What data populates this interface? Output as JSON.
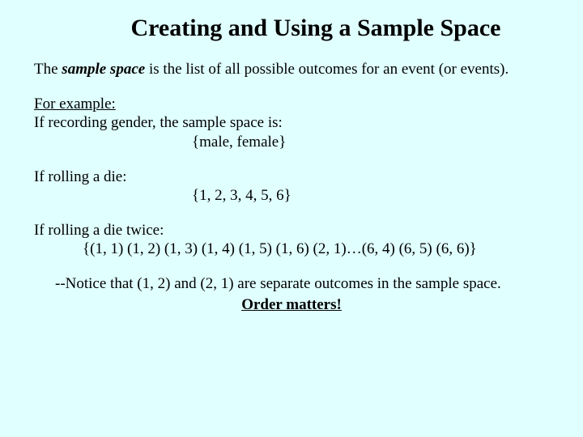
{
  "title": "Creating and Using a Sample Space",
  "intro": {
    "pre": "The ",
    "term": "sample space",
    "post": " is the list of all possible outcomes for an event (or events)."
  },
  "example_label": "For example:",
  "ex1": {
    "prompt": "If recording gender, the sample space is:",
    "space": "{male, female}"
  },
  "ex2": {
    "prompt": "If rolling a die:",
    "space": "{1, 2, 3, 4, 5, 6}"
  },
  "ex3": {
    "prompt": "If rolling a die twice:",
    "space": "{(1, 1) (1, 2) (1, 3) (1, 4) (1, 5) (1, 6) (2, 1)…(6, 4) (6, 5) (6, 6)}"
  },
  "notice_text": "--Notice that (1, 2) and (2, 1) are separate outcomes in the sample space.",
  "order_text": "Order matters!"
}
